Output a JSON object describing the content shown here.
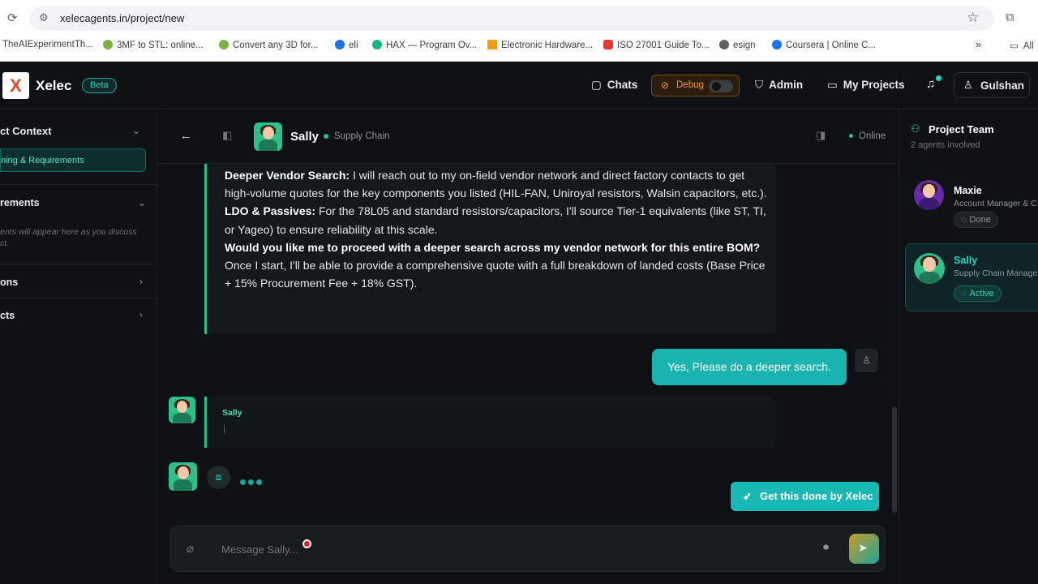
{
  "browser": {
    "url": "xelecagents.in/project/new",
    "bookmarks": [
      {
        "label": "TheAIExperimentTh...",
        "color": "#9aa0a6"
      },
      {
        "label": "3MF to STL: online...",
        "color": "#7cb342"
      },
      {
        "label": "Convert any 3D for...",
        "color": "#7cb342"
      },
      {
        "label": "eli",
        "color": "#1a73e8"
      },
      {
        "label": "HAX — Program Ov...",
        "color": "#12b886"
      },
      {
        "label": "Electronic Hardware...",
        "color": "#f39c12"
      },
      {
        "label": "ISO 27001 Guide To...",
        "color": "#e53935"
      },
      {
        "label": "esign",
        "color": "#5f6368"
      },
      {
        "label": "Coursera | Online C...",
        "color": "#1a73e8"
      }
    ],
    "more_label": "»",
    "all_label": "All"
  },
  "nav": {
    "brand": "Xelec",
    "beta": "Beta",
    "chats": "Chats",
    "debug": "Debug",
    "admin": "Admin",
    "projects": "My Projects",
    "user": "Gulshan"
  },
  "sidebar": {
    "context_title": "ct Context",
    "active_item": "ning & Requirements",
    "requirements_title": "rements",
    "requirements_hint": "ents will appear here as you discuss ct.",
    "section3": "ons",
    "section4": "cts"
  },
  "chat_header": {
    "agent_name": "Sally",
    "agent_role": "Supply Chain",
    "status": "Online"
  },
  "messages": {
    "vendor_label": "Deeper Vendor Search:",
    "vendor_text": " I will reach out to my on-field vendor network and direct factory contacts to get high-volume quotes for the key components you listed (HIL-FAN, Uniroyal resistors, Walsin capacitors, etc.).",
    "ldo_label": "LDO & Passives:",
    "ldo_text": " For the 78L05 and standard resistors/capacitors, I'll source Tier-1 equivalents (like ST, TI, or Yageo) to ensure reliability at this scale.",
    "question": "Would you like me to proceed with a deeper search across my vendor network for this entire BOM?",
    "closing": "Once I start, I'll be able to provide a comprehensive quote with a full breakdown of landed costs (Base Price + 15% Procurement Fee + 18% GST).",
    "user_reply": "Yes, Please do a deeper search.",
    "sally_label": "Sally",
    "cursor": "|"
  },
  "actions": {
    "get_done": "Get this done by Xelec"
  },
  "composer": {
    "placeholder": "Message Sally..."
  },
  "team": {
    "title": "Project Team",
    "subtitle": "2 agents involved",
    "members": [
      {
        "name": "Maxie",
        "role": "Account Manager & C",
        "status": "Done"
      },
      {
        "name": "Sally",
        "role": "Supply Chain Manage",
        "status": "Active"
      }
    ]
  },
  "colors": {
    "accent": "#19b3b0",
    "online": "#24c187",
    "debug": "#f09a2e"
  }
}
